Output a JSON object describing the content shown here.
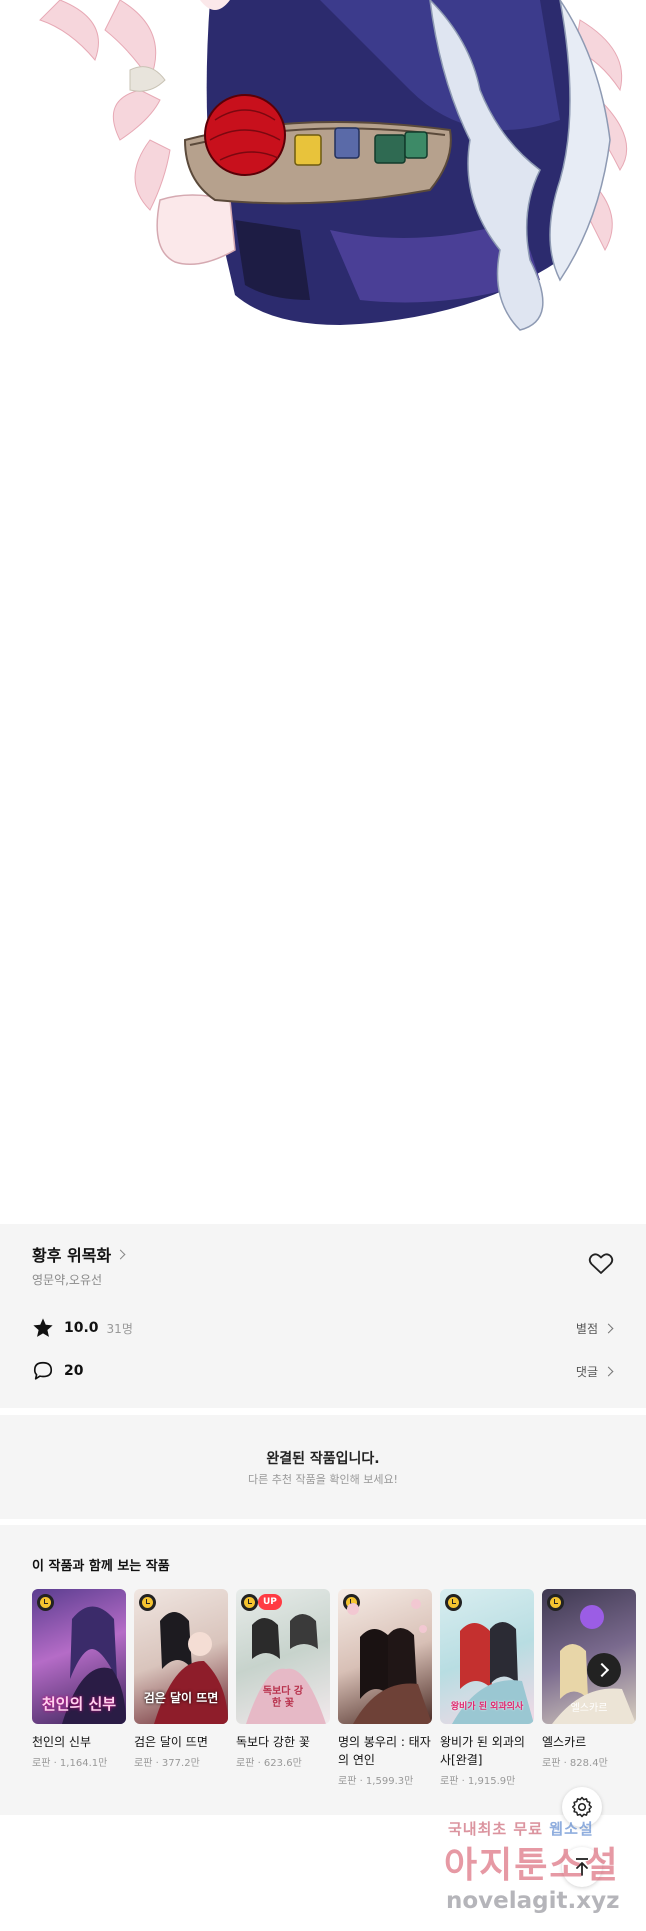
{
  "work": {
    "title": "황후 위목화",
    "authors": "영문약,오유선",
    "rating": "10.0",
    "rating_count": "31명",
    "rating_link": "별점",
    "comment_count": "20",
    "comment_link": "댓글"
  },
  "completed_notice": {
    "title": "완결된 작품입니다.",
    "subtitle": "다른 추천 작품을 확인해 보세요!"
  },
  "recommendations": {
    "heading": "이 작품과 함께 보는 작품",
    "items": [
      {
        "title": "천인의 신부",
        "meta": "로판 · 1,164.1만",
        "cover_text": "천인의 신부",
        "badge": ""
      },
      {
        "title": "검은 달이 뜨면",
        "meta": "로판 · 377.2만",
        "cover_text": "검은 달이 뜨면",
        "badge": ""
      },
      {
        "title": "독보다 강한 꽃",
        "meta": "로판 · 623.6만",
        "cover_text": "독보다 강한 꽃",
        "badge": "UP"
      },
      {
        "title": "명의 봉우리 : 태자의 연인",
        "meta": "로판 · 1,599.3만",
        "cover_text": "",
        "badge": ""
      },
      {
        "title": "왕비가 된 외과의사[완결]",
        "meta": "로판 · 1,915.9만",
        "cover_text": "왕비가 된 외과의사",
        "badge": ""
      },
      {
        "title": "엘스카르",
        "meta": "로판 · 828.4만",
        "cover_text": "엘스카르",
        "badge": ""
      }
    ]
  },
  "watermark": {
    "line1_a": "국내최초 무료",
    "line1_b": "웹소설",
    "line2": "아지툰소설",
    "line3": "novelagit.xyz"
  },
  "colors": {
    "panel_bg": "#f5f5f5",
    "badge_up": "#ff3b43",
    "clock_badge": "#f4c330"
  }
}
